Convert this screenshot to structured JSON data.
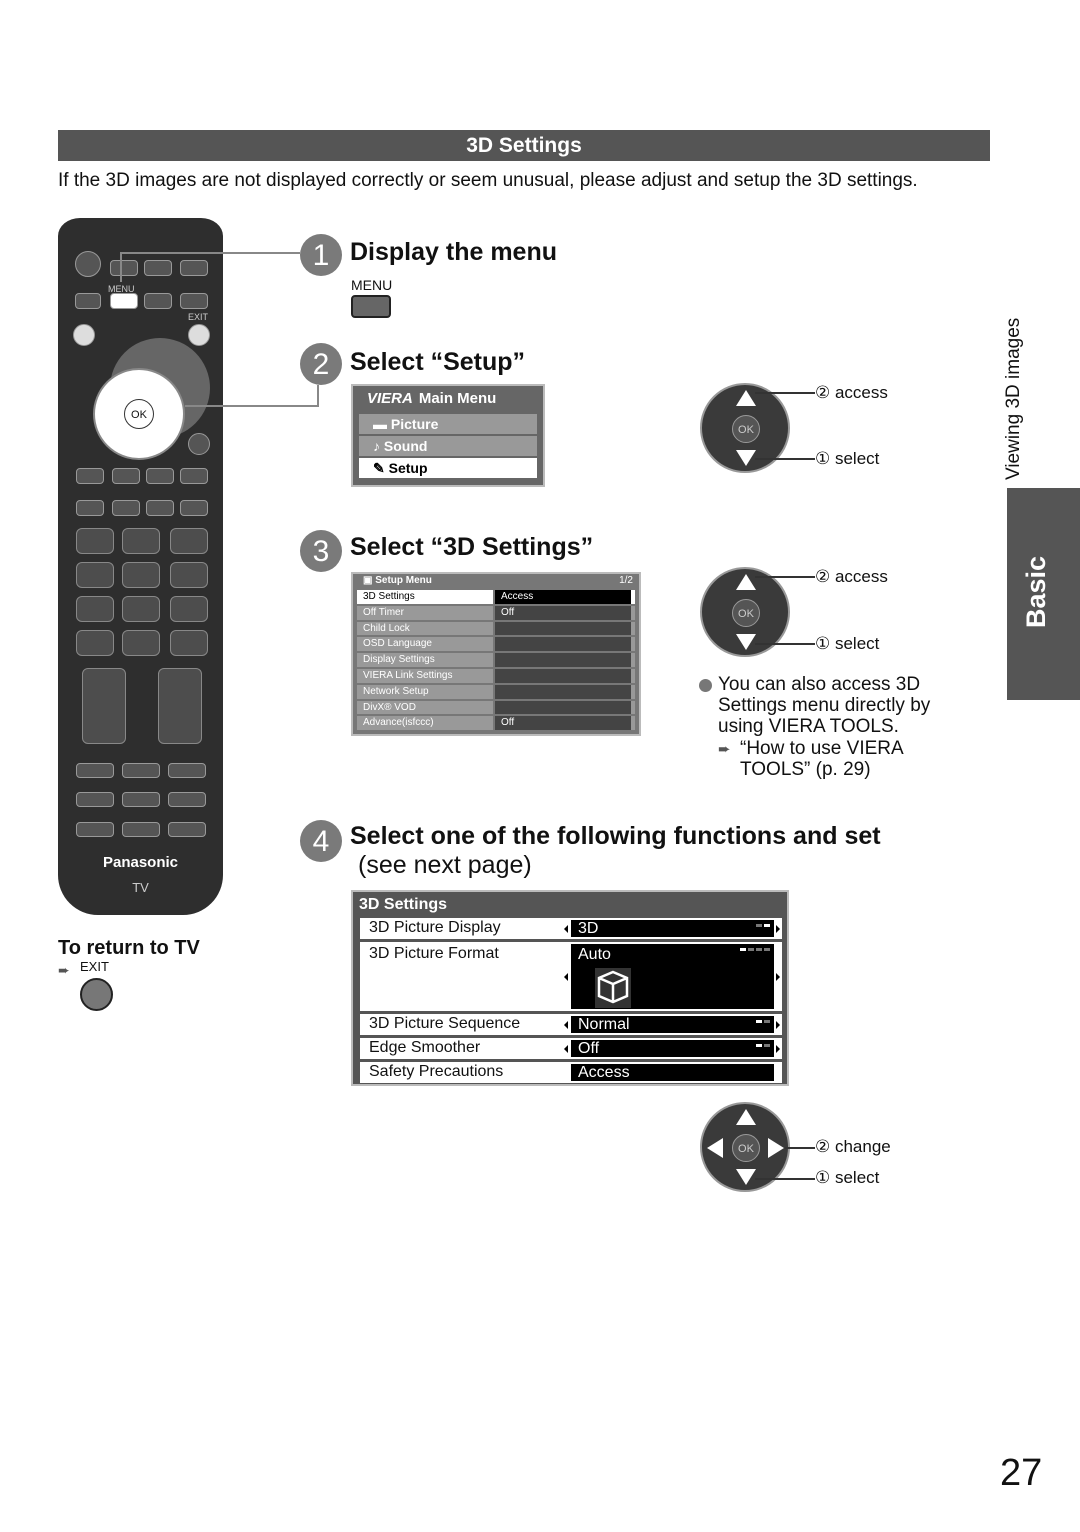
{
  "section": {
    "title": "3D Settings",
    "intro": "If the 3D images are not displayed correctly or seem unusual, please adjust and setup the 3D settings."
  },
  "remote": {
    "menu_label": "MENU",
    "exit_label": "EXIT",
    "ok_label": "OK",
    "brand": "Panasonic",
    "tv_label": "TV"
  },
  "return": {
    "title": "To return to TV",
    "exit_label": "EXIT"
  },
  "steps": [
    {
      "number": "1",
      "title": "Display the menu",
      "button_label": "MENU"
    },
    {
      "number": "2",
      "title": "Select “Setup”"
    },
    {
      "number": "3",
      "title": "Select “3D Settings”"
    },
    {
      "number": "4",
      "title": "Select one of the following functions and set",
      "subtitle": "(see next page)"
    }
  ],
  "main_menu": {
    "logo": "VIERA",
    "title": "Main Menu",
    "items": [
      {
        "label": "Picture",
        "icon": "picture-icon"
      },
      {
        "label": "Sound",
        "icon": "music-note-icon"
      },
      {
        "label": "Setup",
        "icon": "wrench-icon",
        "selected": true
      }
    ]
  },
  "setup_menu": {
    "title": "Setup Menu",
    "page": "1/2",
    "rows": [
      {
        "label": "3D Settings",
        "value": "Access",
        "selected": true
      },
      {
        "label": "Off Timer",
        "value": "Off"
      },
      {
        "label": "Child Lock",
        "value": ""
      },
      {
        "label": "OSD Language",
        "value": ""
      },
      {
        "label": "Display Settings",
        "value": ""
      },
      {
        "label": "VIERA Link Settings",
        "value": ""
      },
      {
        "label": "Network Setup",
        "value": ""
      },
      {
        "label": "DivX® VOD",
        "value": ""
      },
      {
        "label": "Advance(isfccc)",
        "value": "Off"
      }
    ]
  },
  "nav": {
    "step2": {
      "access": "② access",
      "select": "① select"
    },
    "step3": {
      "access": "② access",
      "select": "① select"
    },
    "step4": {
      "change": "② change",
      "select": "① select"
    }
  },
  "note": {
    "text": "You can also access 3D Settings menu directly by using VIERA TOOLS.",
    "ref": "“How to use VIERA TOOLS” (p. 29)"
  },
  "settings_3d": {
    "title": "3D Settings",
    "rows": [
      {
        "label": "3D Picture Display",
        "value": "3D"
      },
      {
        "label": "3D Picture Format",
        "value": "Auto"
      },
      {
        "label": "3D Picture Sequence",
        "value": "Normal"
      },
      {
        "label": "Edge Smoother",
        "value": "Off"
      },
      {
        "label": "Safety Precautions",
        "value": "Access"
      }
    ]
  },
  "sidebar": {
    "chapter": "Viewing 3D images",
    "tab": "Basic"
  },
  "page_number": "27"
}
